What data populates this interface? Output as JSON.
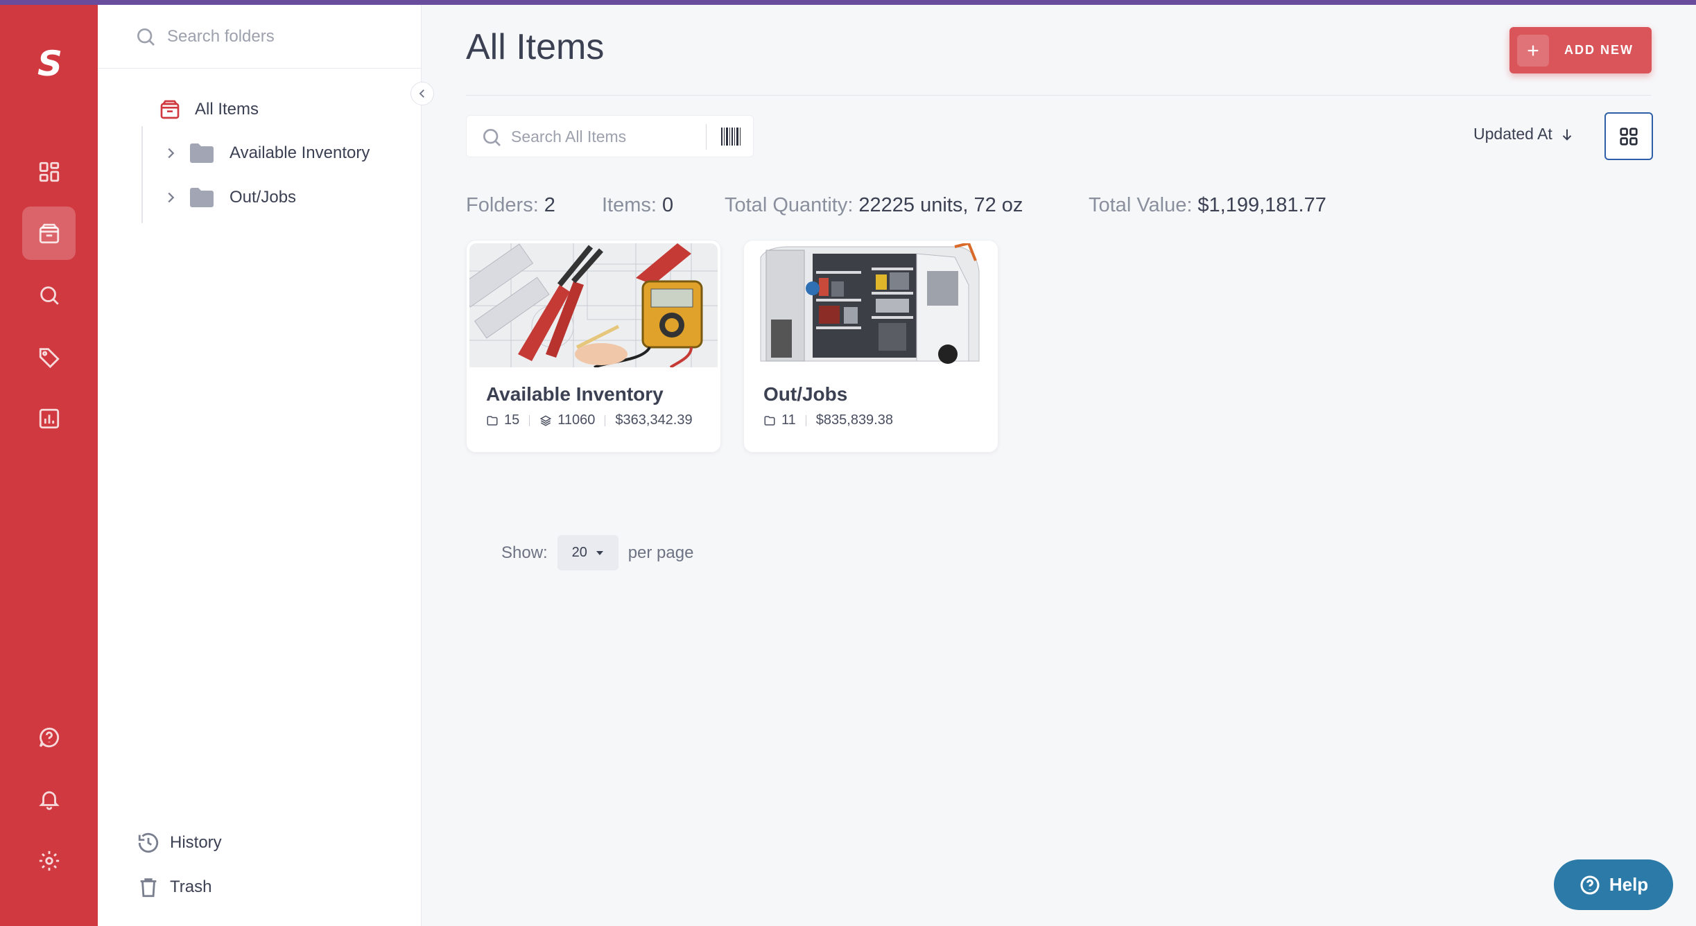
{
  "brand": {
    "logo_letter": "S",
    "accent": "#d0393f"
  },
  "folder_panel": {
    "search_placeholder": "Search folders",
    "all_items_label": "All Items",
    "folders": [
      {
        "label": "Available Inventory"
      },
      {
        "label": "Out/Jobs"
      }
    ],
    "footer": {
      "history": "History",
      "trash": "Trash"
    }
  },
  "header": {
    "title": "All Items",
    "add_button": "ADD NEW"
  },
  "toolbar": {
    "search_placeholder": "Search All Items",
    "sort_label": "Updated At"
  },
  "stats": {
    "folders_label": "Folders:",
    "folders_value": "2",
    "items_label": "Items:",
    "items_value": "0",
    "quantity_label": "Total Quantity:",
    "quantity_value": "22225 units, 72 oz",
    "value_label": "Total Value:",
    "value_value": "$1,199,181.77"
  },
  "cards": [
    {
      "name": "Available Inventory",
      "folders": "15",
      "quantity": "11060",
      "value": "$363,342.39"
    },
    {
      "name": "Out/Jobs",
      "folders": "11",
      "value": "$835,839.38"
    }
  ],
  "pagination": {
    "show_label": "Show:",
    "per_page_value": "20",
    "per_page_label": "per page"
  },
  "help_button": "Help",
  "icons": [
    "search-icon",
    "chevron-left-icon",
    "chevron-right-icon",
    "folder-icon",
    "box-icon",
    "dashboard-icon",
    "tag-icon",
    "report-icon",
    "help-circle-icon",
    "bell-icon",
    "gear-icon",
    "history-icon",
    "trash-icon",
    "plus-icon",
    "barcode-icon",
    "arrow-down-icon",
    "grid-view-icon",
    "layers-icon",
    "caret-down-icon"
  ]
}
